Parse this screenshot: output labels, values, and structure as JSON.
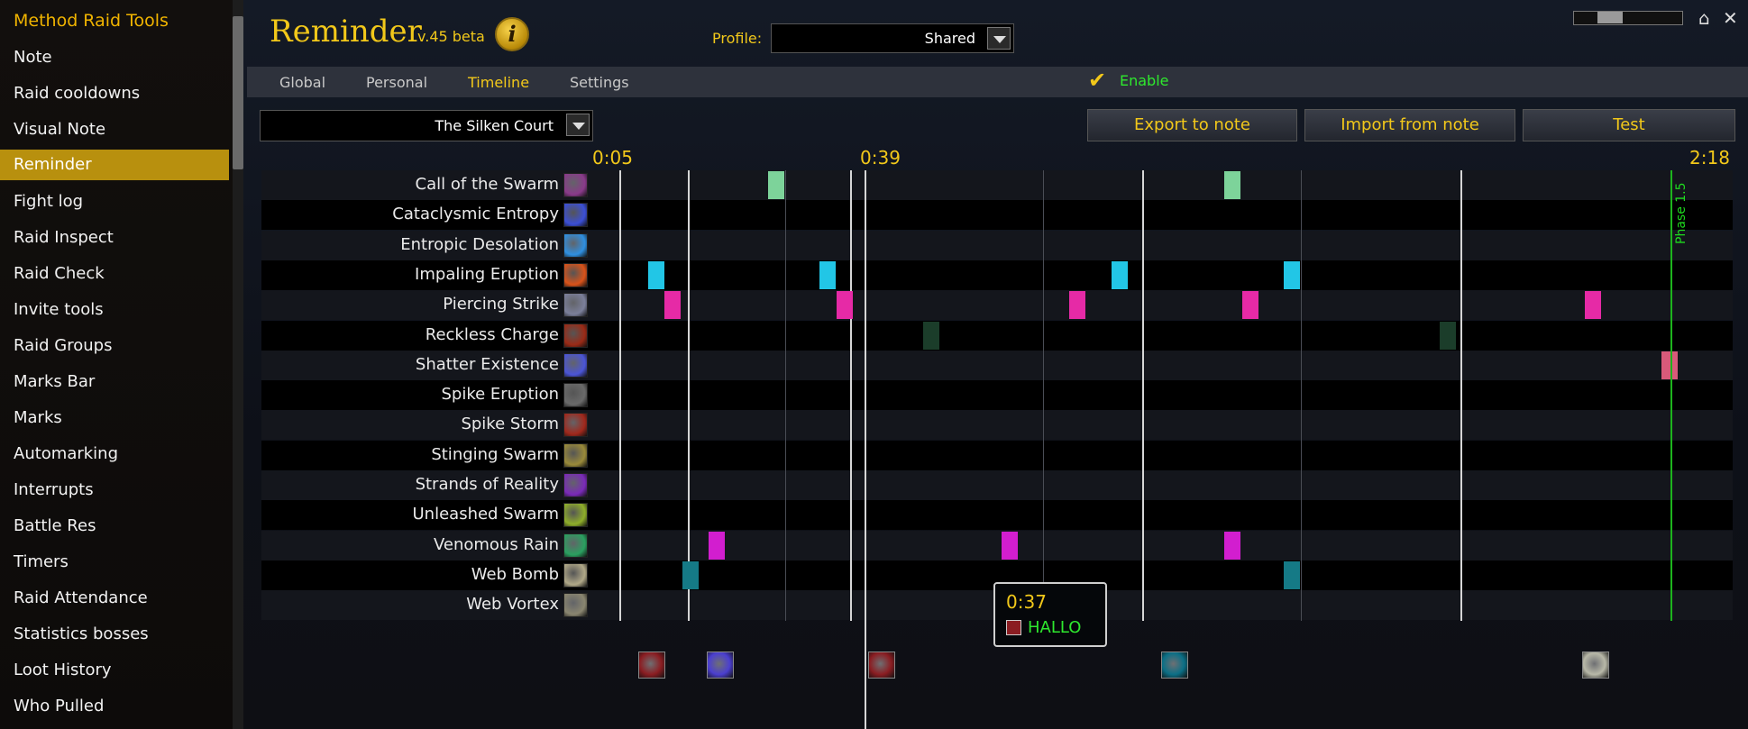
{
  "sidebar": {
    "title": "Method Raid Tools",
    "items": [
      {
        "label": "Note"
      },
      {
        "label": "Raid cooldowns"
      },
      {
        "label": "Visual Note"
      },
      {
        "label": "Reminder"
      },
      {
        "label": "Fight log"
      },
      {
        "label": "Raid Inspect"
      },
      {
        "label": "Raid Check"
      },
      {
        "label": "Invite tools"
      },
      {
        "label": "Raid Groups"
      },
      {
        "label": "Marks Bar"
      },
      {
        "label": "Marks"
      },
      {
        "label": "Automarking"
      },
      {
        "label": "Interrupts"
      },
      {
        "label": "Battle Res"
      },
      {
        "label": "Timers"
      },
      {
        "label": "Raid Attendance"
      },
      {
        "label": "Statistics bosses"
      },
      {
        "label": "Loot History"
      },
      {
        "label": "Who Pulled"
      }
    ],
    "active_item": "Reminder"
  },
  "header": {
    "title": "Reminder",
    "version": "v.45 beta",
    "info_glyph": "i",
    "profile_label": "Profile:",
    "profile_value": "Shared"
  },
  "tabs": [
    {
      "label": "Global"
    },
    {
      "label": "Personal"
    },
    {
      "label": "Timeline"
    },
    {
      "label": "Settings"
    }
  ],
  "active_tab": "Timeline",
  "enable": {
    "label": "Enable",
    "checked": true
  },
  "boss_select": {
    "value": "The Silken Court"
  },
  "buttons": {
    "export": "Export to note",
    "import": "Import from note",
    "test": "Test"
  },
  "timeline": {
    "time_labels": [
      "0:05",
      "0:39",
      "2:18"
    ],
    "phase_label": "Phase 1.5",
    "rows": [
      {
        "label": "Call of the Swarm",
        "icon": "call-of-the-swarm-icon",
        "icon_color": "#8a3a8a"
      },
      {
        "label": "Cataclysmic Entropy",
        "icon": "cataclysmic-entropy-icon",
        "icon_color": "#3b4fd6"
      },
      {
        "label": "Entropic Desolation",
        "icon": "entropic-desolation-icon",
        "icon_color": "#2f8fe0"
      },
      {
        "label": "Impaling Eruption",
        "icon": "impaling-eruption-icon",
        "icon_color": "#d9531a"
      },
      {
        "label": "Piercing Strike",
        "icon": "piercing-strike-icon",
        "icon_color": "#7b7f9a"
      },
      {
        "label": "Reckless Charge",
        "icon": "reckless-charge-icon",
        "icon_color": "#9a2a16"
      },
      {
        "label": "Shatter Existence",
        "icon": "shatter-existence-icon",
        "icon_color": "#4b55d6"
      },
      {
        "label": "Spike Eruption",
        "icon": "spike-eruption-icon",
        "icon_color": "#6a6a6a"
      },
      {
        "label": "Spike Storm",
        "icon": "spike-storm-icon",
        "icon_color": "#a0281c"
      },
      {
        "label": "Stinging Swarm",
        "icon": "stinging-swarm-icon",
        "icon_color": "#9a8a3a"
      },
      {
        "label": "Strands of Reality",
        "icon": "strands-of-reality-icon",
        "icon_color": "#7a2ab8"
      },
      {
        "label": "Unleashed Swarm",
        "icon": "unleashed-swarm-icon",
        "icon_color": "#8fae2a"
      },
      {
        "label": "Venomous Rain",
        "icon": "venomous-rain-icon",
        "icon_color": "#2aa060"
      },
      {
        "label": "Web Bomb",
        "icon": "web-bomb-icon",
        "icon_color": "#b0a888"
      },
      {
        "label": "Web Vortex",
        "icon": "web-vortex-icon",
        "icon_color": "#8a8670"
      }
    ],
    "marker_colors": {
      "green": "#7dd39a",
      "cyan": "#22c6e6",
      "pink": "#e62aa6",
      "darkgreen": "#1b3d2a",
      "rose": "#d85a7a",
      "magenta": "#d21ecf",
      "teal": "#157a86"
    },
    "bottom_icons": [
      "spike-storm-icon",
      "cataclysmic-entropy-icon",
      "spike-storm-icon",
      "web-bomb-icon",
      "scroll-icon"
    ]
  },
  "tooltip": {
    "time": "0:37",
    "text": "HALLO",
    "icon": "spike-storm-icon"
  },
  "colors": {
    "accent_gold": "#f2c81a",
    "active_sidebar": "#b8900e",
    "enable_green": "#2ee82e"
  }
}
